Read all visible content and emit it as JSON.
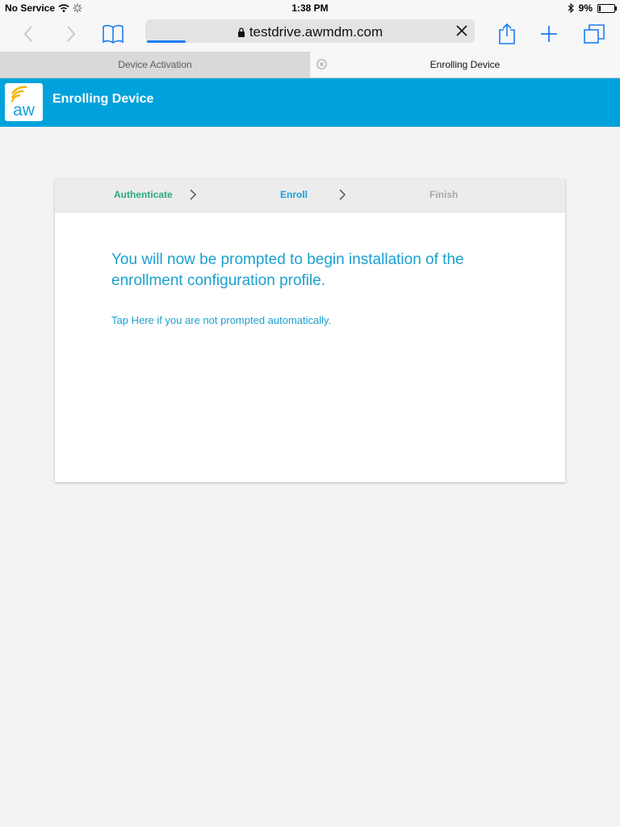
{
  "status_bar": {
    "carrier": "No Service",
    "time": "1:38 PM",
    "battery_percent": "9%",
    "battery_level": 0.09
  },
  "toolbar": {
    "url": "testdrive.awmdm.com",
    "icons": [
      "back-icon",
      "forward-icon",
      "bookmarks-icon",
      "lock-icon",
      "close-icon",
      "share-icon",
      "add-icon",
      "tabs-icon"
    ],
    "accent_color": "#1b7cf2"
  },
  "tabs": [
    {
      "label": "Device Activation",
      "active": false
    },
    {
      "label": "Enrolling Device",
      "active": true
    }
  ],
  "app_header": {
    "title": "Enrolling Device",
    "logo_text": "aw",
    "background_color": "#00a2dc"
  },
  "steps": [
    {
      "label": "Authenticate",
      "state": "done",
      "color": "#2aaa7c"
    },
    {
      "label": "Enroll",
      "state": "current",
      "color": "#1a9fd8"
    },
    {
      "label": "Finish",
      "state": "pending",
      "color": "#a8a8a8"
    }
  ],
  "content": {
    "message": "You will now be prompted to begin installation of the enrollment configuration profile.",
    "link_text": "Tap Here if you are not prompted automatically."
  }
}
